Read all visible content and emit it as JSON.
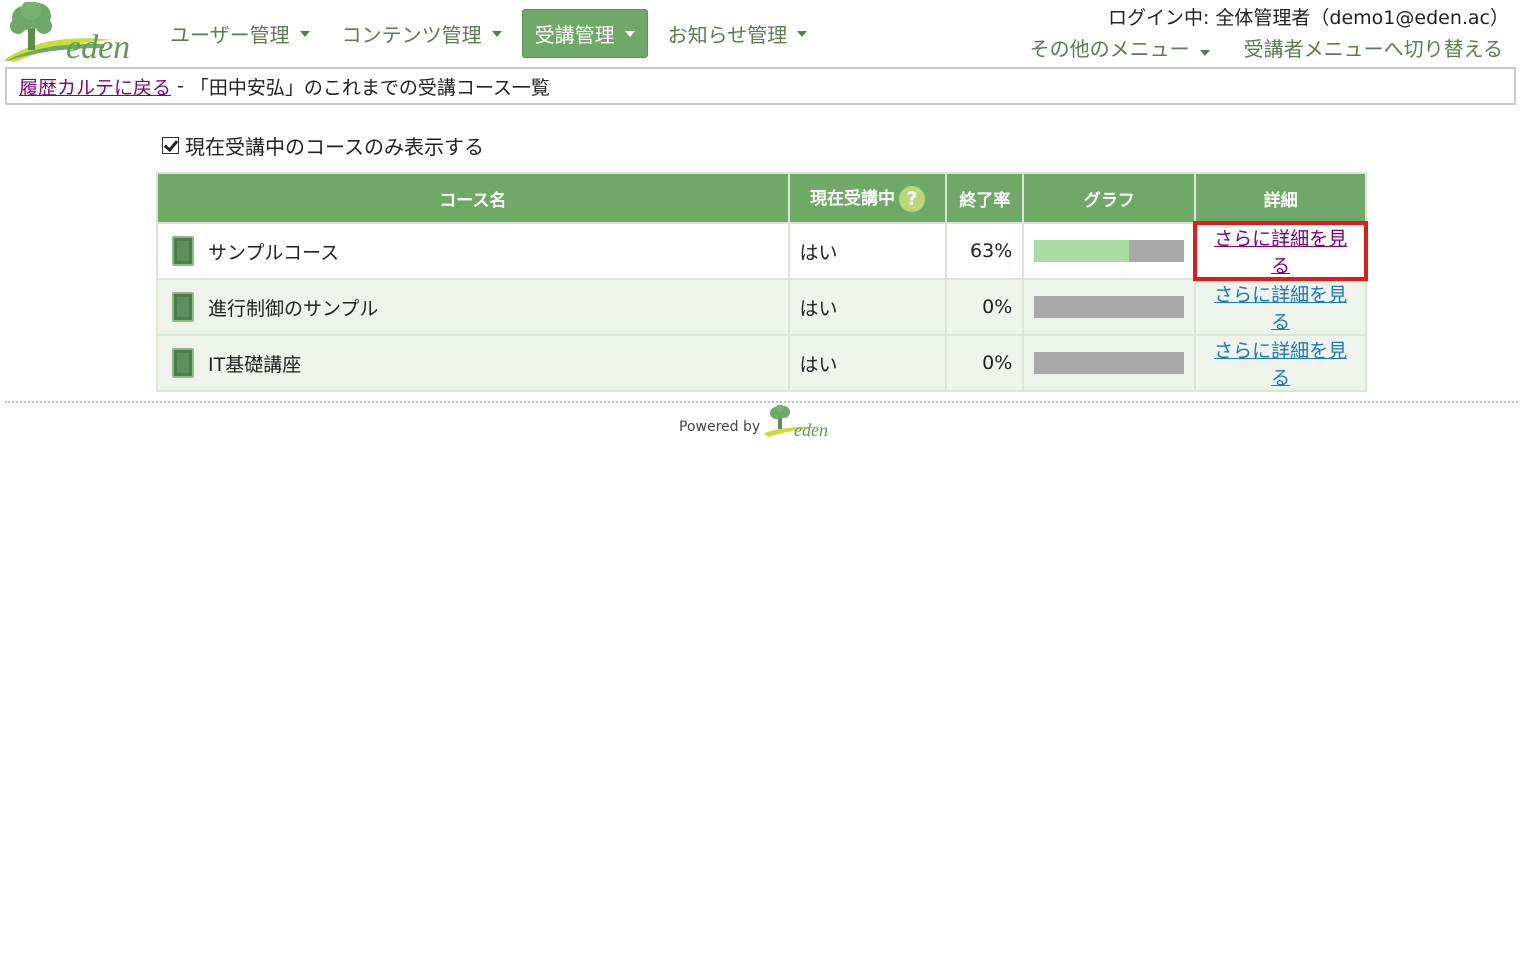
{
  "header": {
    "logo_text": "eden",
    "nav": [
      {
        "label": "ユーザー管理",
        "active": false
      },
      {
        "label": "コンテンツ管理",
        "active": false
      },
      {
        "label": "受講管理",
        "active": true
      },
      {
        "label": "お知らせ管理",
        "active": false
      }
    ],
    "login_text": "ログイン中: 全体管理者（demo1@eden.ac）",
    "other_menu": "その他のメニュー",
    "switch_menu": "受講者メニューへ切り替える"
  },
  "breadcrumb": {
    "back_link": "履歴カルテに戻る",
    "separator": "-",
    "title": "「田中安弘」のこれまでの受講コース一覧"
  },
  "filter": {
    "checked": true,
    "label": "現在受講中のコースのみ表示する"
  },
  "table": {
    "headers": {
      "name": "コース名",
      "current": "現在受講中",
      "rate": "終了率",
      "graph": "グラフ",
      "detail": "詳細"
    },
    "help_icon": "?",
    "rows": [
      {
        "name": "サンプルコース",
        "current": "はい",
        "rate": "63%",
        "progress": 0.63,
        "detail": "さらに詳細を見る"
      },
      {
        "name": "進行制御のサンプル",
        "current": "はい",
        "rate": "0%",
        "progress": 0,
        "detail": "さらに詳細を見る"
      },
      {
        "name": "IT基礎講座",
        "current": "はい",
        "rate": "0%",
        "progress": 0,
        "detail": "さらに詳細を見る"
      }
    ]
  },
  "footer": {
    "powered_by": "Powered by",
    "logo_text": "eden"
  },
  "colors": {
    "accent": "#70a967",
    "link": "#1a78c2",
    "visited": "#800080",
    "highlight": "#e31a1a",
    "bar_fill": "#a9dba3",
    "bar_bg": "#a9a9a9"
  }
}
